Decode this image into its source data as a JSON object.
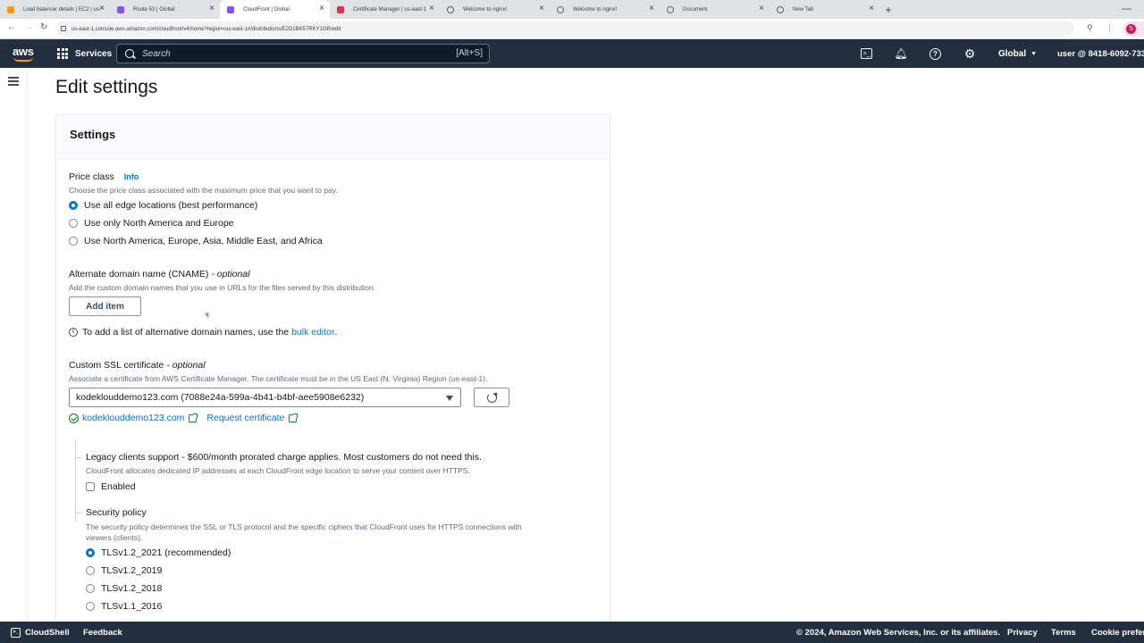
{
  "browser": {
    "tabs": [
      {
        "title": "Load balancer details | EC2 | us-",
        "color": "#ff9900",
        "globe": false,
        "active": false
      },
      {
        "title": "Route 53 | Global",
        "color": "#8c4fff",
        "globe": false,
        "active": false
      },
      {
        "title": "CloudFront | Global",
        "color": "#8c4fff",
        "globe": false,
        "active": true
      },
      {
        "title": "Certificate Manager | us-east-1",
        "color": "#dd344c",
        "globe": false,
        "active": false
      },
      {
        "title": "Welcome to nginx!",
        "color": "",
        "globe": true,
        "active": false
      },
      {
        "title": "Welcome to nginx!",
        "color": "",
        "globe": true,
        "active": false
      },
      {
        "title": "Document",
        "color": "",
        "globe": true,
        "active": false
      },
      {
        "title": "New Tab",
        "color": "",
        "globe": true,
        "active": false
      }
    ],
    "url": "us-east-1.console.aws.amazon.com/cloudfront/v4/home?region=us-east-1#/distributions/E2D1BK57RKY1GR/edit",
    "profile_initial": "S"
  },
  "topnav": {
    "logo": "aws",
    "services_label": "Services",
    "search_placeholder": "Search",
    "search_shortcut": "[Alt+S]",
    "cloudshell_icon_text": ">_",
    "help_icon_text": "?",
    "region_label": "Global",
    "user_label": "user @ 8418-6092-733"
  },
  "page": {
    "title": "Edit settings",
    "panel_title": "Settings"
  },
  "price_class": {
    "label": "Price class",
    "info": "Info",
    "description": "Choose the price class associated with the maximum price that you want to pay.",
    "options": [
      "Use all edge locations (best performance)",
      "Use only North America and Europe",
      "Use North America, Europe, Asia, Middle East, and Africa"
    ],
    "selected_index": 0
  },
  "cname": {
    "label": "Alternate domain name (CNAME)",
    "optional": "- optional",
    "description": "Add the custom domain names that you use in URLs for the files served by this distribution.",
    "add_button": "Add item",
    "note_prefix": "To add a list of alternative domain names, use the",
    "note_link": "bulk editor",
    "note_suffix": "."
  },
  "ssl": {
    "label": "Custom SSL certificate",
    "optional": "- optional",
    "description": "Associate a certificate from AWS Certificate Manager. The certificate must be in the US East (N. Virginia) Region (us-east-1).",
    "selected_value": "kodeklouddemo123.com (7088e24a-599a-4b41-b4bf-aee5908e6232)",
    "domain_link": "kodeklouddemo123.com",
    "request_link": "Request certificate"
  },
  "legacy": {
    "label": "Legacy clients support - $600/month prorated charge applies. Most customers do not need this.",
    "description": "CloudFront allocates dedicated IP addresses at each CloudFront edge location to serve your content over HTTPS.",
    "checkbox_label": "Enabled",
    "checked": false
  },
  "security_policy": {
    "label": "Security policy",
    "description_line1": "The security policy determines the SSL or TLS protocol and the specific ciphers that CloudFront uses for HTTPS connections with",
    "description_line2": "viewers (clients).",
    "options": [
      "TLSv1.2_2021 (recommended)",
      "TLSv1.2_2019",
      "TLSv1.2_2018",
      "TLSv1.1_2016"
    ],
    "selected_index": 0
  },
  "footer": {
    "cloudshell": "CloudShell",
    "feedback": "Feedback",
    "copyright": "© 2024, Amazon Web Services, Inc. or its affiliates.",
    "privacy": "Privacy",
    "terms": "Terms",
    "cookies": "Cookie preferences"
  }
}
